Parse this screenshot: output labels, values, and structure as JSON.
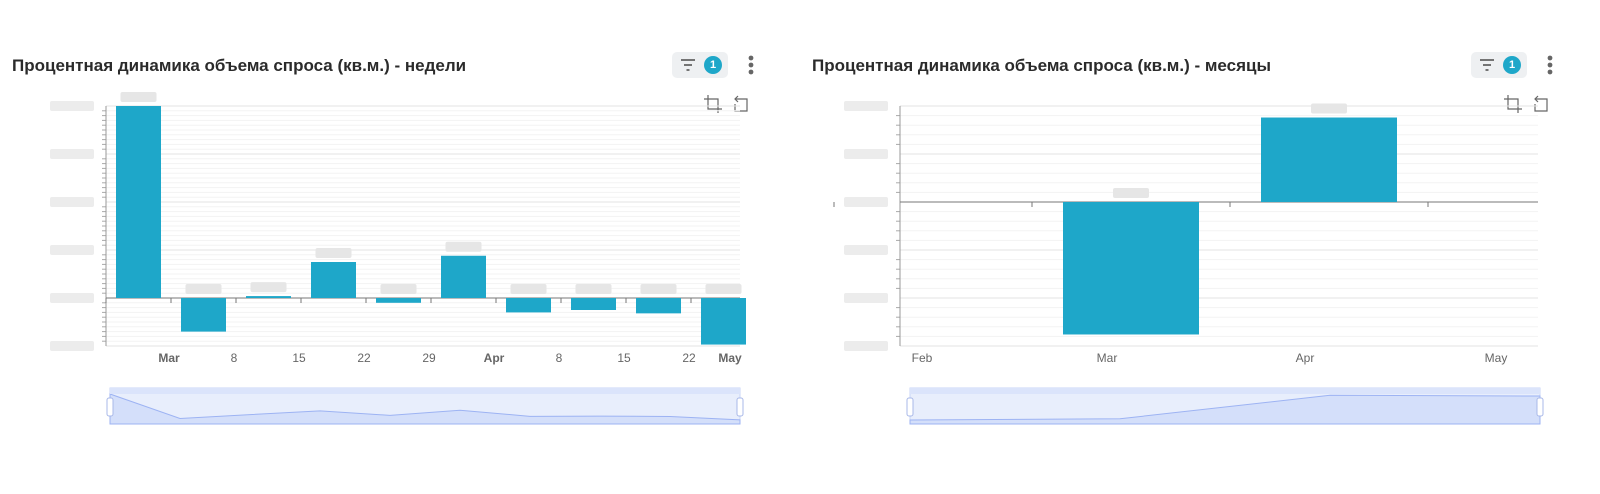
{
  "panels": [
    {
      "title": "Процентная динамика объема спроса (кв.м.) - недели",
      "filter_count": "1",
      "icons": [
        "filter-icon",
        "more-vertical-icon",
        "zoom-select-icon",
        "zoom-reset-icon"
      ]
    },
    {
      "title": "Процентная динамика объема спроса (кв.м.) - месяцы",
      "filter_count": "1",
      "icons": [
        "filter-icon",
        "more-vertical-icon",
        "zoom-select-icon",
        "zoom-reset-icon"
      ]
    }
  ],
  "colors": {
    "bar": "#1ea7c9",
    "badge": "#1ea7c9",
    "datazoom_fill": "#d9e3fb",
    "datazoom_line": "#9db3f3"
  },
  "chart_data": [
    {
      "type": "bar",
      "title": "Процентная динамика объема спроса (кв.м.) - недели",
      "categories": [
        "1 Mar",
        "8 Mar",
        "15 Mar",
        "22 Mar",
        "29 Mar",
        "5 Apr",
        "12 Apr",
        "19 Apr",
        "26 Apr",
        "3 May"
      ],
      "x_tick_labels": [
        {
          "label": "Mar",
          "bold": true
        },
        {
          "label": "8",
          "bold": false
        },
        {
          "label": "15",
          "bold": false
        },
        {
          "label": "22",
          "bold": false
        },
        {
          "label": "29",
          "bold": false
        },
        {
          "label": "Apr",
          "bold": true
        },
        {
          "label": "8",
          "bold": false
        },
        {
          "label": "15",
          "bold": false
        },
        {
          "label": "22",
          "bold": false
        },
        {
          "label": "May",
          "bold": true
        }
      ],
      "values": [
        400,
        -70,
        4,
        75,
        -10,
        88,
        -30,
        -25,
        -32,
        -97
      ],
      "ylim": [
        -100,
        400
      ],
      "y_gridlines": [
        -100,
        0,
        100,
        200,
        300,
        400
      ],
      "y_tick_labels_visible": false,
      "data_labels_visible": false,
      "grid": true,
      "legend": "none",
      "datazoom": true
    },
    {
      "type": "bar",
      "title": "Процентная динамика объема спроса (кв.м.) - месяцы",
      "categories": [
        "Feb",
        "Mar",
        "Apr",
        "May"
      ],
      "x_tick_labels": [
        {
          "label": "Feb",
          "bold": false
        },
        {
          "label": "Mar",
          "bold": false
        },
        {
          "label": "Apr",
          "bold": false
        },
        {
          "label": "May",
          "bold": false
        }
      ],
      "values": [
        null,
        -69,
        44,
        null
      ],
      "ylim": [
        -75,
        50
      ],
      "y_gridlines": [
        -75,
        -50,
        -25,
        0,
        25,
        50
      ],
      "y_tick_labels_visible": false,
      "data_labels_visible": false,
      "grid": true,
      "legend": "none",
      "datazoom": true
    }
  ]
}
